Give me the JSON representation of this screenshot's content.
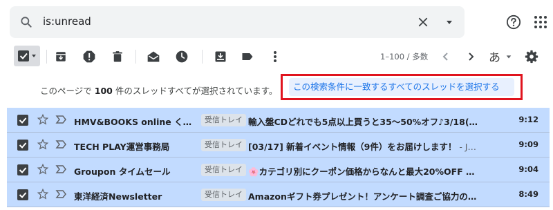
{
  "search": {
    "query": "is:unread",
    "icons": [
      "search-icon",
      "clear-icon",
      "search-options-icon",
      "help-icon",
      "apps-icon"
    ]
  },
  "toolbar": {
    "icons": [
      "select-all-checkbox",
      "archive-icon",
      "report-spam-icon",
      "delete-icon",
      "mark-read-icon",
      "snooze-icon",
      "move-to-inbox-icon",
      "label-icon",
      "more-icon",
      "prev-page-icon",
      "next-page-icon",
      "settings-icon"
    ],
    "page_count": "1–100 / 多数",
    "input_tool": "あ"
  },
  "banner": {
    "prefix": "このページで",
    "count": "100",
    "suffix": "件のスレッドすべてが選択されています。",
    "select_all_link": "この検索条件に一致するすべてのスレッドを選択する"
  },
  "emails": [
    {
      "sender": "HMV&BOOKS online く…",
      "label": "受信トレイ",
      "subject": "輸入盤CDどれでも5点以上買うと35～50%オフ♪3/18(…",
      "snippet": "",
      "time": "9:12"
    },
    {
      "sender": "TECH PLAY運営事務局",
      "label": "受信トレイ",
      "subject": "[03/17] 新着イベント情報（9件）をお届けします！",
      "snippet": " - J…",
      "time": "9:09"
    },
    {
      "sender": "Groupon タイムセール",
      "label": "受信トレイ",
      "subject": "🌸カテゴリ別にクーポン価格からなんと最大20%OFF …",
      "snippet": "",
      "time": "9:04"
    },
    {
      "sender": "東洋経済Newsletter",
      "label": "受信トレイ",
      "subject": "Amazonギフト券プレゼント！アンケート調査ご協力の…",
      "snippet": "",
      "time": "8:49"
    }
  ],
  "colors": {
    "selected_row": "#c2dbff",
    "link": "#1a73e8",
    "highlight_box": "#e0141e"
  }
}
